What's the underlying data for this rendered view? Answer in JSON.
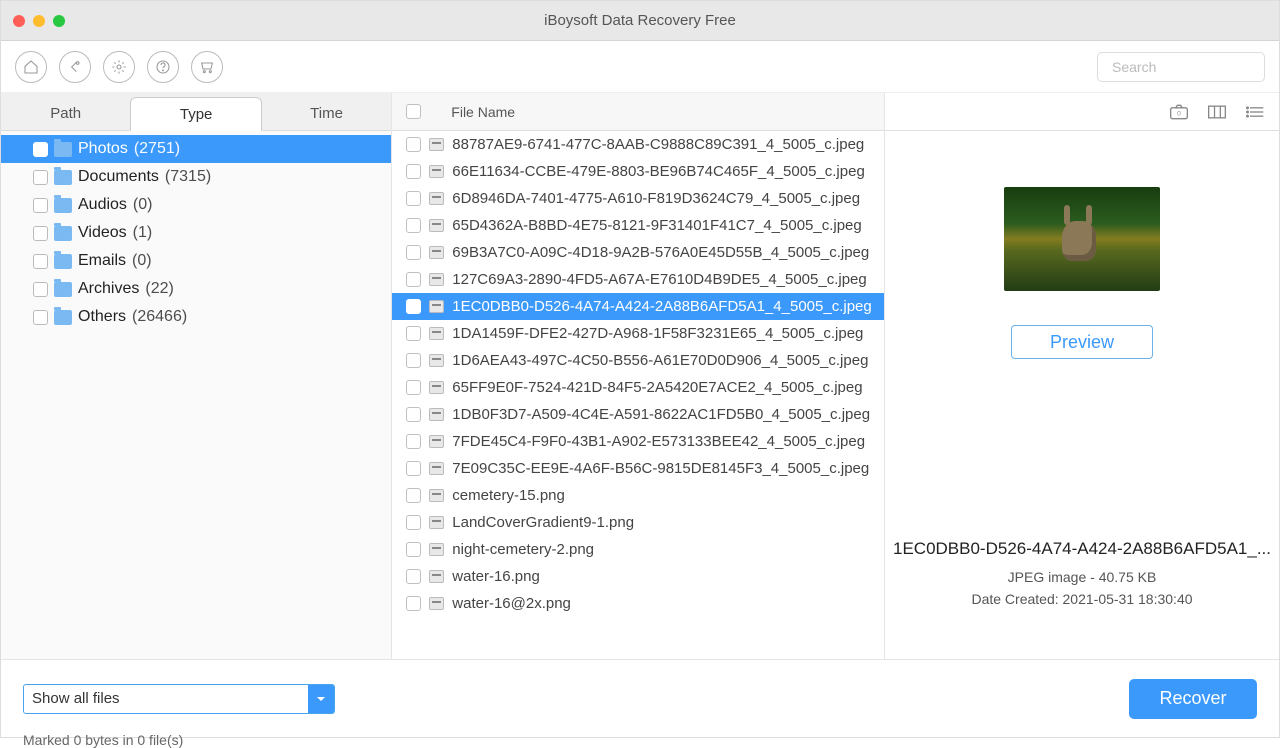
{
  "window": {
    "title": "iBoysoft Data Recovery Free"
  },
  "search": {
    "placeholder": "Search"
  },
  "tabs": {
    "path": "Path",
    "type": "Type",
    "time": "Time",
    "active": "type"
  },
  "categories": [
    {
      "name": "Photos",
      "count": "(2751)",
      "selected": true
    },
    {
      "name": "Documents",
      "count": "(7315)",
      "selected": false
    },
    {
      "name": "Audios",
      "count": "(0)",
      "selected": false
    },
    {
      "name": "Videos",
      "count": "(1)",
      "selected": false
    },
    {
      "name": "Emails",
      "count": "(0)",
      "selected": false
    },
    {
      "name": "Archives",
      "count": "(22)",
      "selected": false
    },
    {
      "name": "Others",
      "count": "(26466)",
      "selected": false
    }
  ],
  "fileHeader": {
    "colName": "File Name"
  },
  "files": [
    {
      "name": "88787AE9-6741-477C-8AAB-C9888C89C391_4_5005_c.jpeg",
      "selected": false
    },
    {
      "name": "66E11634-CCBE-479E-8803-BE96B74C465F_4_5005_c.jpeg",
      "selected": false
    },
    {
      "name": "6D8946DA-7401-4775-A610-F819D3624C79_4_5005_c.jpeg",
      "selected": false
    },
    {
      "name": "65D4362A-B8BD-4E75-8121-9F31401F41C7_4_5005_c.jpeg",
      "selected": false
    },
    {
      "name": "69B3A7C0-A09C-4D18-9A2B-576A0E45D55B_4_5005_c.jpeg",
      "selected": false
    },
    {
      "name": "127C69A3-2890-4FD5-A67A-E7610D4B9DE5_4_5005_c.jpeg",
      "selected": false
    },
    {
      "name": "1EC0DBB0-D526-4A74-A424-2A88B6AFD5A1_4_5005_c.jpeg",
      "selected": true
    },
    {
      "name": "1DA1459F-DFE2-427D-A968-1F58F3231E65_4_5005_c.jpeg",
      "selected": false
    },
    {
      "name": "1D6AEA43-497C-4C50-B556-A61E70D0D906_4_5005_c.jpeg",
      "selected": false
    },
    {
      "name": "65FF9E0F-7524-421D-84F5-2A5420E7ACE2_4_5005_c.jpeg",
      "selected": false
    },
    {
      "name": "1DB0F3D7-A509-4C4E-A591-8622AC1FD5B0_4_5005_c.jpeg",
      "selected": false
    },
    {
      "name": "7FDE45C4-F9F0-43B1-A902-E573133BEE42_4_5005_c.jpeg",
      "selected": false
    },
    {
      "name": "7E09C35C-EE9E-4A6F-B56C-9815DE8145F3_4_5005_c.jpeg",
      "selected": false
    },
    {
      "name": "cemetery-15.png",
      "selected": false
    },
    {
      "name": "LandCoverGradient9-1.png",
      "selected": false
    },
    {
      "name": "night-cemetery-2.png",
      "selected": false
    },
    {
      "name": "water-16.png",
      "selected": false
    },
    {
      "name": "water-16@2x.png",
      "selected": false
    }
  ],
  "preview": {
    "button": "Preview",
    "fileName": "1EC0DBB0-D526-4A74-A424-2A88B6AFD5A1_...",
    "meta1": "JPEG image - 40.75 KB",
    "meta2": "Date Created: 2021-05-31 18:30:40"
  },
  "footer": {
    "filter": "Show all files",
    "marked": "Marked 0 bytes in 0 file(s)",
    "recover": "Recover"
  },
  "views": {
    "camera_badge": "0"
  }
}
